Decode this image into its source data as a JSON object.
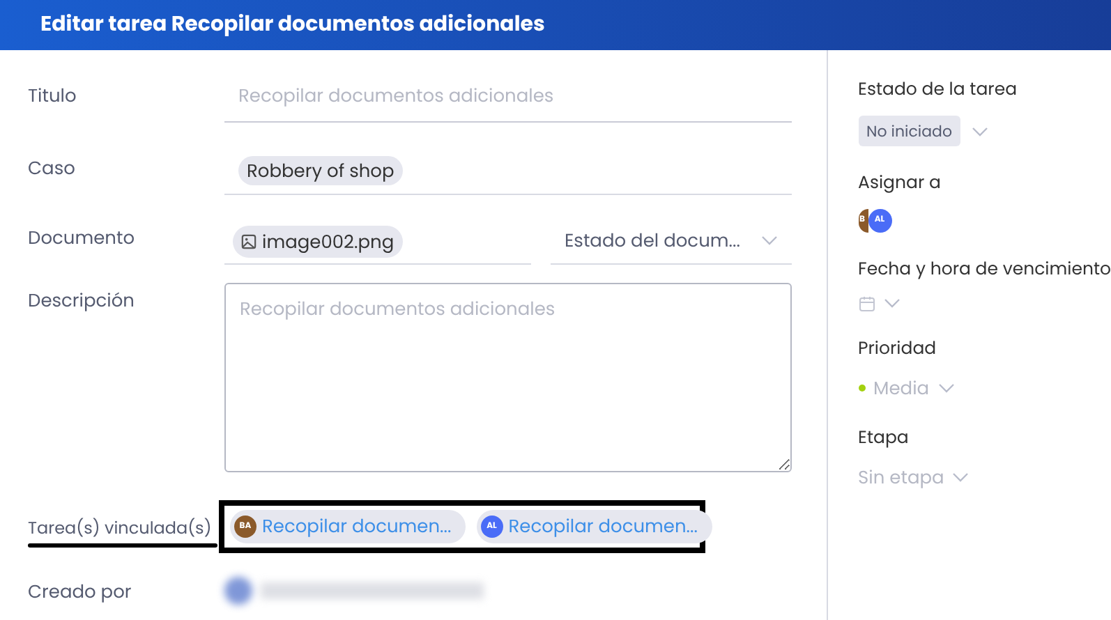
{
  "dialog": {
    "title": "Editar tarea Recopilar documentos adicionales"
  },
  "fields": [
    {
      "kind": "text",
      "label": "Titulo",
      "placeholder": "Recopilar documentos adicionales"
    },
    {
      "kind": "chip",
      "label": "Caso",
      "value": "Robbery of shop"
    },
    {
      "kind": "document",
      "label": "Documento",
      "value": "image002.png",
      "status": "Estado del docum..."
    },
    {
      "kind": "textarea",
      "label": "Descripción",
      "placeholder": "Recopilar documentos adicionales"
    },
    {
      "kind": "linked",
      "label": "Tarea(s) vinculada(s)",
      "tasks": [
        {
          "initials": "BA",
          "color": "#8b5a2b",
          "title": "Recopilar documen..."
        },
        {
          "initials": "AL",
          "color": "#4a6cf7",
          "title": "Recopilar documen..."
        }
      ]
    },
    {
      "kind": "redacted",
      "label": "Creado por"
    }
  ],
  "sidebar": [
    {
      "kind": "status",
      "label": "Estado de la tarea",
      "value": "No iniciado"
    },
    {
      "kind": "assignees",
      "label": "Asignar a",
      "avatars": [
        {
          "initials": "B",
          "color": "#8b5a2b"
        },
        {
          "initials": "AL",
          "color": "#4a6cf7"
        }
      ]
    },
    {
      "kind": "date",
      "label": "Fecha y hora de vencimiento"
    },
    {
      "kind": "priority",
      "label": "Prioridad",
      "value": "Media",
      "color": "#a3d10f"
    },
    {
      "kind": "plain",
      "label": "Etapa",
      "value": "Sin etapa"
    }
  ]
}
